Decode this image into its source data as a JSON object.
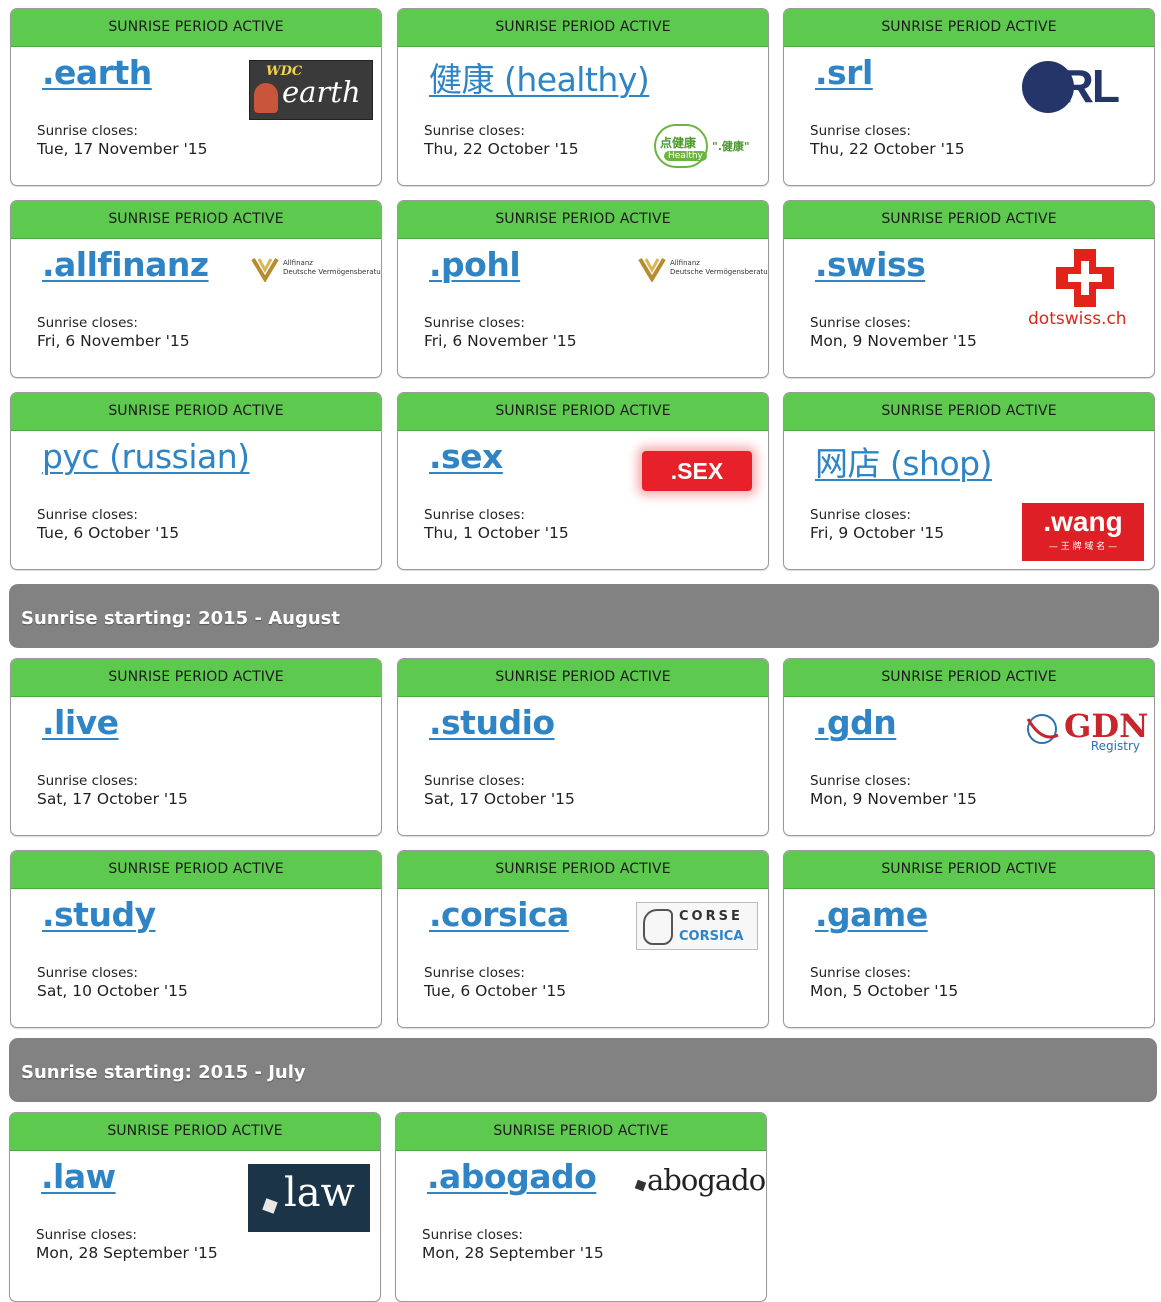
{
  "badge": "SUNRISE PERIOD ACTIVE",
  "closes_label": "Sunrise closes:",
  "groups": [
    {
      "banner": ""
    },
    {
      "banner": "Sunrise starting: 2015 - August"
    },
    {
      "banner": "Sunrise starting: 2015 - July"
    }
  ],
  "cards": [
    {
      "tld": ".earth",
      "closes": "Tue, 17 November '15",
      "logo": "earth-logo",
      "logo_text_1": "WDC",
      "logo_text_2": "earth"
    },
    {
      "tld": "健康 (healthy)",
      "closes": "Thu, 22 October '15",
      "logo": "healthy-logo",
      "logo_text_1": "点健康",
      "logo_text_2": "\".健康\"",
      "logo_text_3": "Healthy"
    },
    {
      "tld": ".srl",
      "closes": "Thu, 22 October '15",
      "logo": "srl-logo",
      "logo_text_1": "SRL"
    },
    {
      "tld": ".allfinanz",
      "closes": "Fri, 6 November '15",
      "logo": "allfinanz-logo",
      "logo_text_1": "Allfinanz",
      "logo_text_2": "Deutsche Vermögensberatung"
    },
    {
      "tld": ".pohl",
      "closes": "Fri, 6 November '15",
      "logo": "allfinanz-logo",
      "logo_text_1": "Allfinanz",
      "logo_text_2": "Deutsche Vermögensberatung"
    },
    {
      "tld": ".swiss",
      "closes": "Mon, 9 November '15",
      "logo": "dotswiss-logo",
      "logo_text_1": "dotswiss.ch"
    },
    {
      "tld": "pyc (russian)",
      "closes": "Tue, 6 October '15",
      "logo": ""
    },
    {
      "tld": ".sex",
      "closes": "Thu, 1 October '15",
      "logo": "sex-logo",
      "logo_text_1": ".SEX"
    },
    {
      "tld": "网店 (shop)",
      "closes": "Fri, 9 October '15",
      "logo": "wang-logo",
      "logo_text_1": ".wang",
      "logo_text_2": "— 王 牌 域 名 —"
    },
    {
      "tld": ".live",
      "closes": "Sat, 17 October '15",
      "logo": ""
    },
    {
      "tld": ".studio",
      "closes": "Sat, 17 October '15",
      "logo": ""
    },
    {
      "tld": ".gdn",
      "closes": "Mon, 9 November '15",
      "logo": "gdn-logo",
      "logo_text_1": "GDN",
      "logo_text_2": "Registry"
    },
    {
      "tld": ".study",
      "closes": "Sat, 10 October '15",
      "logo": ""
    },
    {
      "tld": ".corsica",
      "closes": "Tue, 6 October '15",
      "logo": "corsica-logo",
      "logo_text_1": "CORSE",
      "logo_text_2": "CORSICA"
    },
    {
      "tld": ".game",
      "closes": "Mon, 5 October '15",
      "logo": ""
    },
    {
      "tld": ".law",
      "closes": "Mon, 28 September '15",
      "logo": "law-logo",
      "logo_text_1": "law"
    },
    {
      "tld": ".abogado",
      "closes": "Mon, 28 September '15",
      "logo": "abogado-logo",
      "logo_text_1": "abogado"
    }
  ],
  "colors": {
    "header_green": "#5ec94f",
    "link_blue": "#2f84c5",
    "banner_gray": "#828282"
  }
}
